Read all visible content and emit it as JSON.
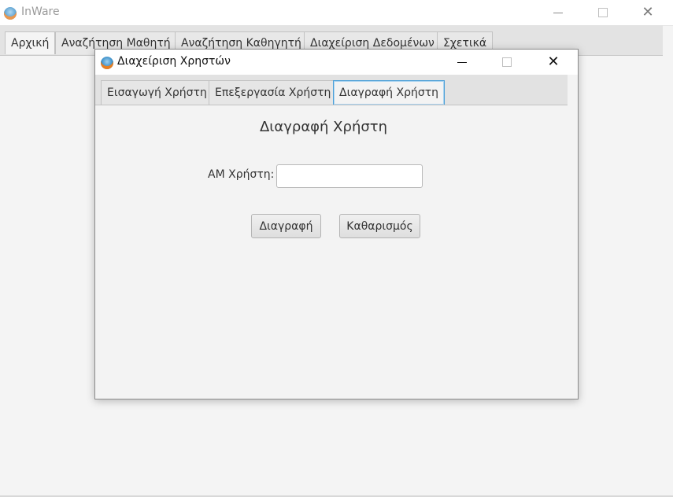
{
  "main_window": {
    "title": "InWare",
    "tabs": [
      {
        "label": "Αρχική"
      },
      {
        "label": "Αναζήτηση Μαθητή"
      },
      {
        "label": "Αναζήτηση Καθηγητή"
      },
      {
        "label": "Διαχείριση Δεδομένων"
      },
      {
        "label": "Σχετικά"
      }
    ],
    "icon": "inware-app-icon"
  },
  "dialog": {
    "title": "Διαχείριση Χρηστών",
    "tabs": [
      {
        "label": "Εισαγωγή Χρήστη"
      },
      {
        "label": "Επεξεργασία Χρήστη"
      },
      {
        "label": "Διαγραφή Χρήστη"
      }
    ],
    "active_tab": "Διαγραφή Χρήστη",
    "panel": {
      "heading": "Διαγραφή Χρήστη",
      "am_label": "ΑΜ Χρήστη:",
      "am_value": "",
      "delete_button": "Διαγραφή",
      "clear_button": "Καθαρισμός"
    }
  },
  "colors": {
    "active_tab_border": "#4a9fd8",
    "window_background": "#f4f4f4"
  }
}
